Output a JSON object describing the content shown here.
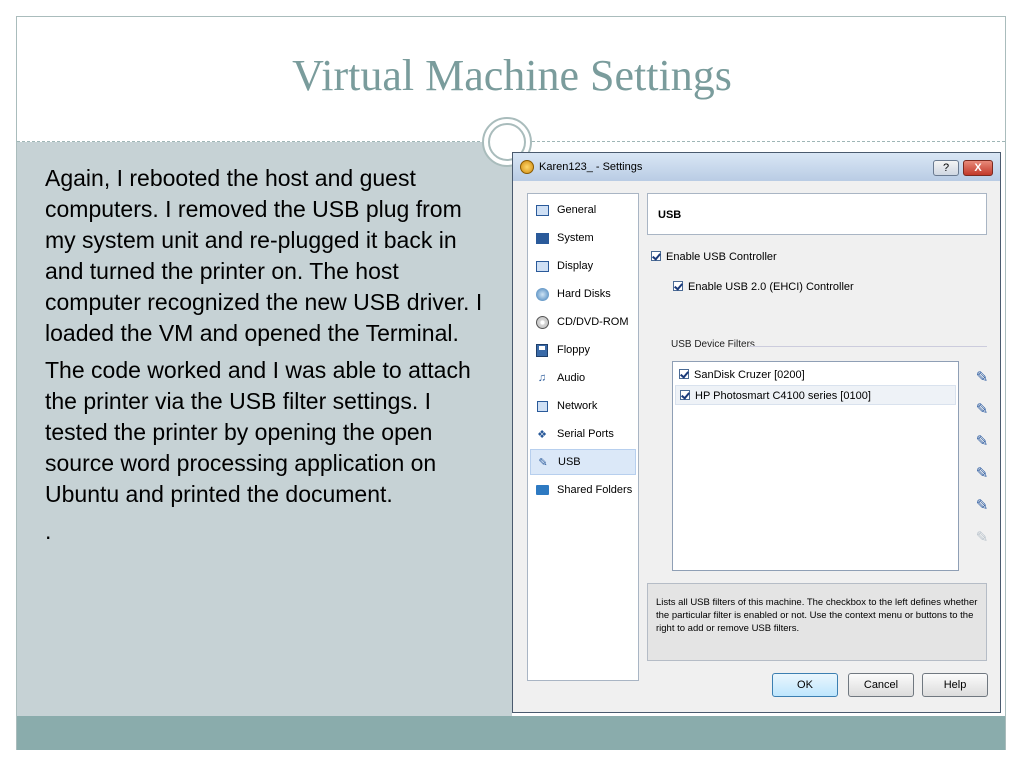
{
  "slide": {
    "title": "Virtual Machine Settings",
    "paragraphs": [
      "Again, I rebooted the host and guest computers.  I removed the USB plug from my system unit and re-plugged it back in and turned the printer on.  The host computer recognized the new USB driver.  I loaded the VM and opened the Terminal.",
      "The code worked and I was able to attach the printer via the USB filter settings.  I tested the printer by opening the open source word processing application on Ubuntu and printed the document.",
      "."
    ]
  },
  "dialog": {
    "title": "Karen123_ - Settings",
    "help_label": "?",
    "close_label": "X",
    "sidebar": {
      "items": [
        {
          "label": "General",
          "icon": "general-icon"
        },
        {
          "label": "System",
          "icon": "system-icon"
        },
        {
          "label": "Display",
          "icon": "display-icon"
        },
        {
          "label": "Hard Disks",
          "icon": "hard-disk-icon"
        },
        {
          "label": "CD/DVD-ROM",
          "icon": "cd-icon"
        },
        {
          "label": "Floppy",
          "icon": "floppy-icon"
        },
        {
          "label": "Audio",
          "icon": "audio-icon"
        },
        {
          "label": "Network",
          "icon": "network-icon"
        },
        {
          "label": "Serial Ports",
          "icon": "serial-ports-icon"
        },
        {
          "label": "USB",
          "icon": "usb-icon",
          "selected": true
        },
        {
          "label": "Shared Folders",
          "icon": "shared-folders-icon"
        }
      ]
    },
    "usb": {
      "header": "USB",
      "enable_controller": {
        "label": "Enable USB Controller",
        "checked": true
      },
      "enable_usb2": {
        "label": "Enable USB 2.0 (EHCI) Controller",
        "checked": true
      },
      "filters_group_label": "USB Device Filters",
      "filters": [
        {
          "label": "SanDisk Cruzer [0200]",
          "checked": true
        },
        {
          "label": "HP Photosmart C4100 series [0100]",
          "checked": true,
          "selected": true
        }
      ],
      "tools": [
        {
          "name": "add-empty-filter-icon",
          "enabled": true
        },
        {
          "name": "add-filter-from-device-icon",
          "enabled": true
        },
        {
          "name": "edit-filter-icon",
          "enabled": true
        },
        {
          "name": "remove-filter-icon",
          "enabled": true
        },
        {
          "name": "move-filter-up-icon",
          "enabled": true
        },
        {
          "name": "move-filter-down-icon",
          "enabled": false
        }
      ],
      "info": "Lists all USB filters of this machine. The checkbox to the left defines whether the particular filter is enabled or not. Use the context menu or buttons to the right to add or remove USB filters."
    },
    "buttons": {
      "ok": "OK",
      "cancel": "Cancel",
      "help": "Help"
    }
  },
  "colors": {
    "title": "#7a9c9c",
    "left_panel": "#c6d2d5",
    "footer_bar": "#8aacac"
  }
}
